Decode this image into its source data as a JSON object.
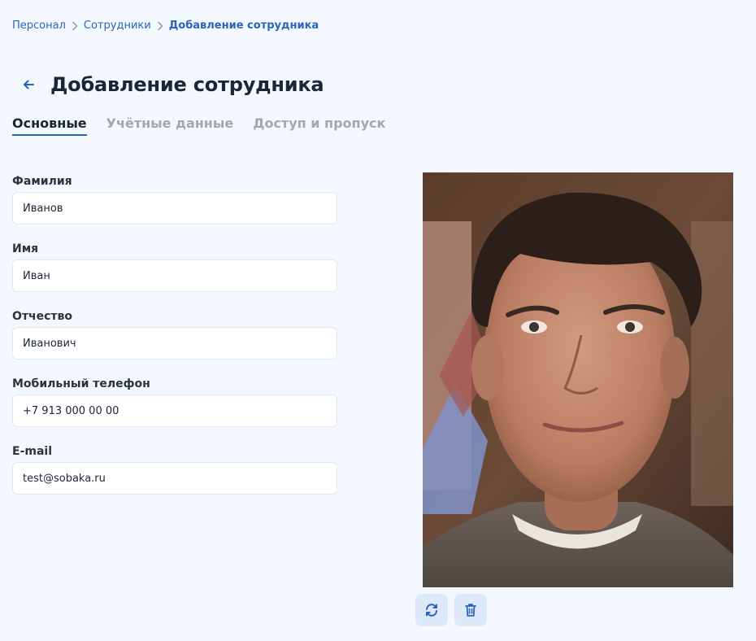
{
  "breadcrumb": {
    "items": [
      "Персонал",
      "Сотрудники",
      "Добавление сотрудника"
    ]
  },
  "header": {
    "back_icon": "arrow-left-icon",
    "title": "Добавление сотрудника"
  },
  "tabs": [
    {
      "label": "Основные",
      "active": true
    },
    {
      "label": "Учётные данные",
      "active": false
    },
    {
      "label": "Доступ и пропуск",
      "active": false
    }
  ],
  "form": {
    "fields": [
      {
        "label": "Фамилия",
        "value": "Иванов"
      },
      {
        "label": "Имя",
        "value": "Иван"
      },
      {
        "label": "Отчество",
        "value": "Иванович"
      },
      {
        "label": "Мобильный телефон",
        "value": "+7 913 000 00 00"
      },
      {
        "label": "E-mail",
        "value": "test@sobaka.ru"
      }
    ]
  },
  "photo": {
    "actions": [
      {
        "icon": "refresh-icon"
      },
      {
        "icon": "trash-icon"
      }
    ]
  },
  "colors": {
    "background": "#f3f8fe",
    "accent": "#2e63b8",
    "tab_inactive": "#a3a8b0",
    "button_bg": "#dde9fb"
  }
}
